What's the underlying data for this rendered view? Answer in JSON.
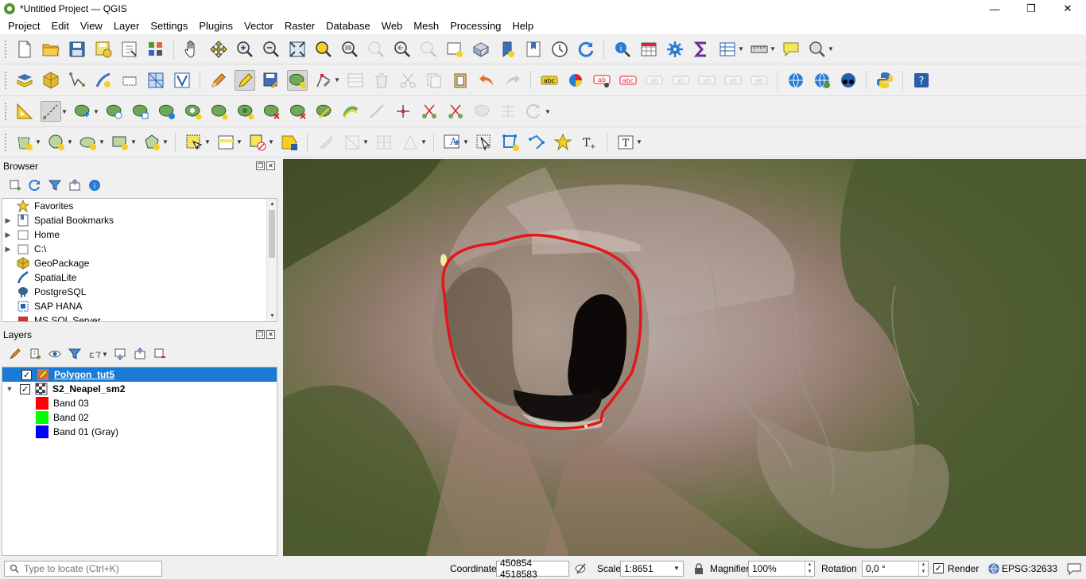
{
  "window": {
    "title": "*Untitled Project — QGIS",
    "controls": [
      "—",
      "❐",
      "✕"
    ]
  },
  "menubar": [
    "Project",
    "Edit",
    "View",
    "Layer",
    "Settings",
    "Plugins",
    "Vector",
    "Raster",
    "Database",
    "Web",
    "Mesh",
    "Processing",
    "Help"
  ],
  "browser": {
    "title": "Browser",
    "items": [
      {
        "label": "Favorites",
        "icon": "star-icon",
        "expand": false
      },
      {
        "label": "Spatial Bookmarks",
        "icon": "bookmarks-icon",
        "expand": true
      },
      {
        "label": "Home",
        "icon": "folder-icon",
        "expand": true
      },
      {
        "label": "C:\\",
        "icon": "drive-icon",
        "expand": true
      },
      {
        "label": "GeoPackage",
        "icon": "geopackage-icon",
        "expand": false
      },
      {
        "label": "SpatiaLite",
        "icon": "spatialite-icon",
        "expand": false
      },
      {
        "label": "PostgreSQL",
        "icon": "postgresql-icon",
        "expand": false
      },
      {
        "label": "SAP HANA",
        "icon": "sap-hana-icon",
        "expand": false
      },
      {
        "label": "MS SQL Server",
        "icon": "mssql-icon",
        "expand": false
      }
    ]
  },
  "layers": {
    "title": "Layers",
    "items": [
      {
        "name": "Polygon_tut5",
        "checked": true,
        "selected": true
      },
      {
        "name": "S2_Neapel_sm2",
        "checked": true,
        "selected": false
      }
    ],
    "bands": [
      {
        "label": "Band 03",
        "color": "#ff0000"
      },
      {
        "label": "Band 02",
        "color": "#00ff00"
      },
      {
        "label": "Band 01 (Gray)",
        "color": "#0000ff"
      }
    ]
  },
  "statusbar": {
    "locator_placeholder": "Type to locate (Ctrl+K)",
    "coordinate_label": "Coordinate",
    "coordinate_value": "450854 4518583",
    "scale_label": "Scale",
    "scale_value": "1:8651",
    "magnifier_label": "Magnifier",
    "magnifier_value": "100%",
    "rotation_label": "Rotation",
    "rotation_value": "0,0 °",
    "render_label": "Render",
    "render_checked": true,
    "crs": "EPSG:32633"
  },
  "colors": {
    "selection": "#1a7ad4",
    "polygon_outline": "#e3161b",
    "qgis_green": "#589632"
  }
}
